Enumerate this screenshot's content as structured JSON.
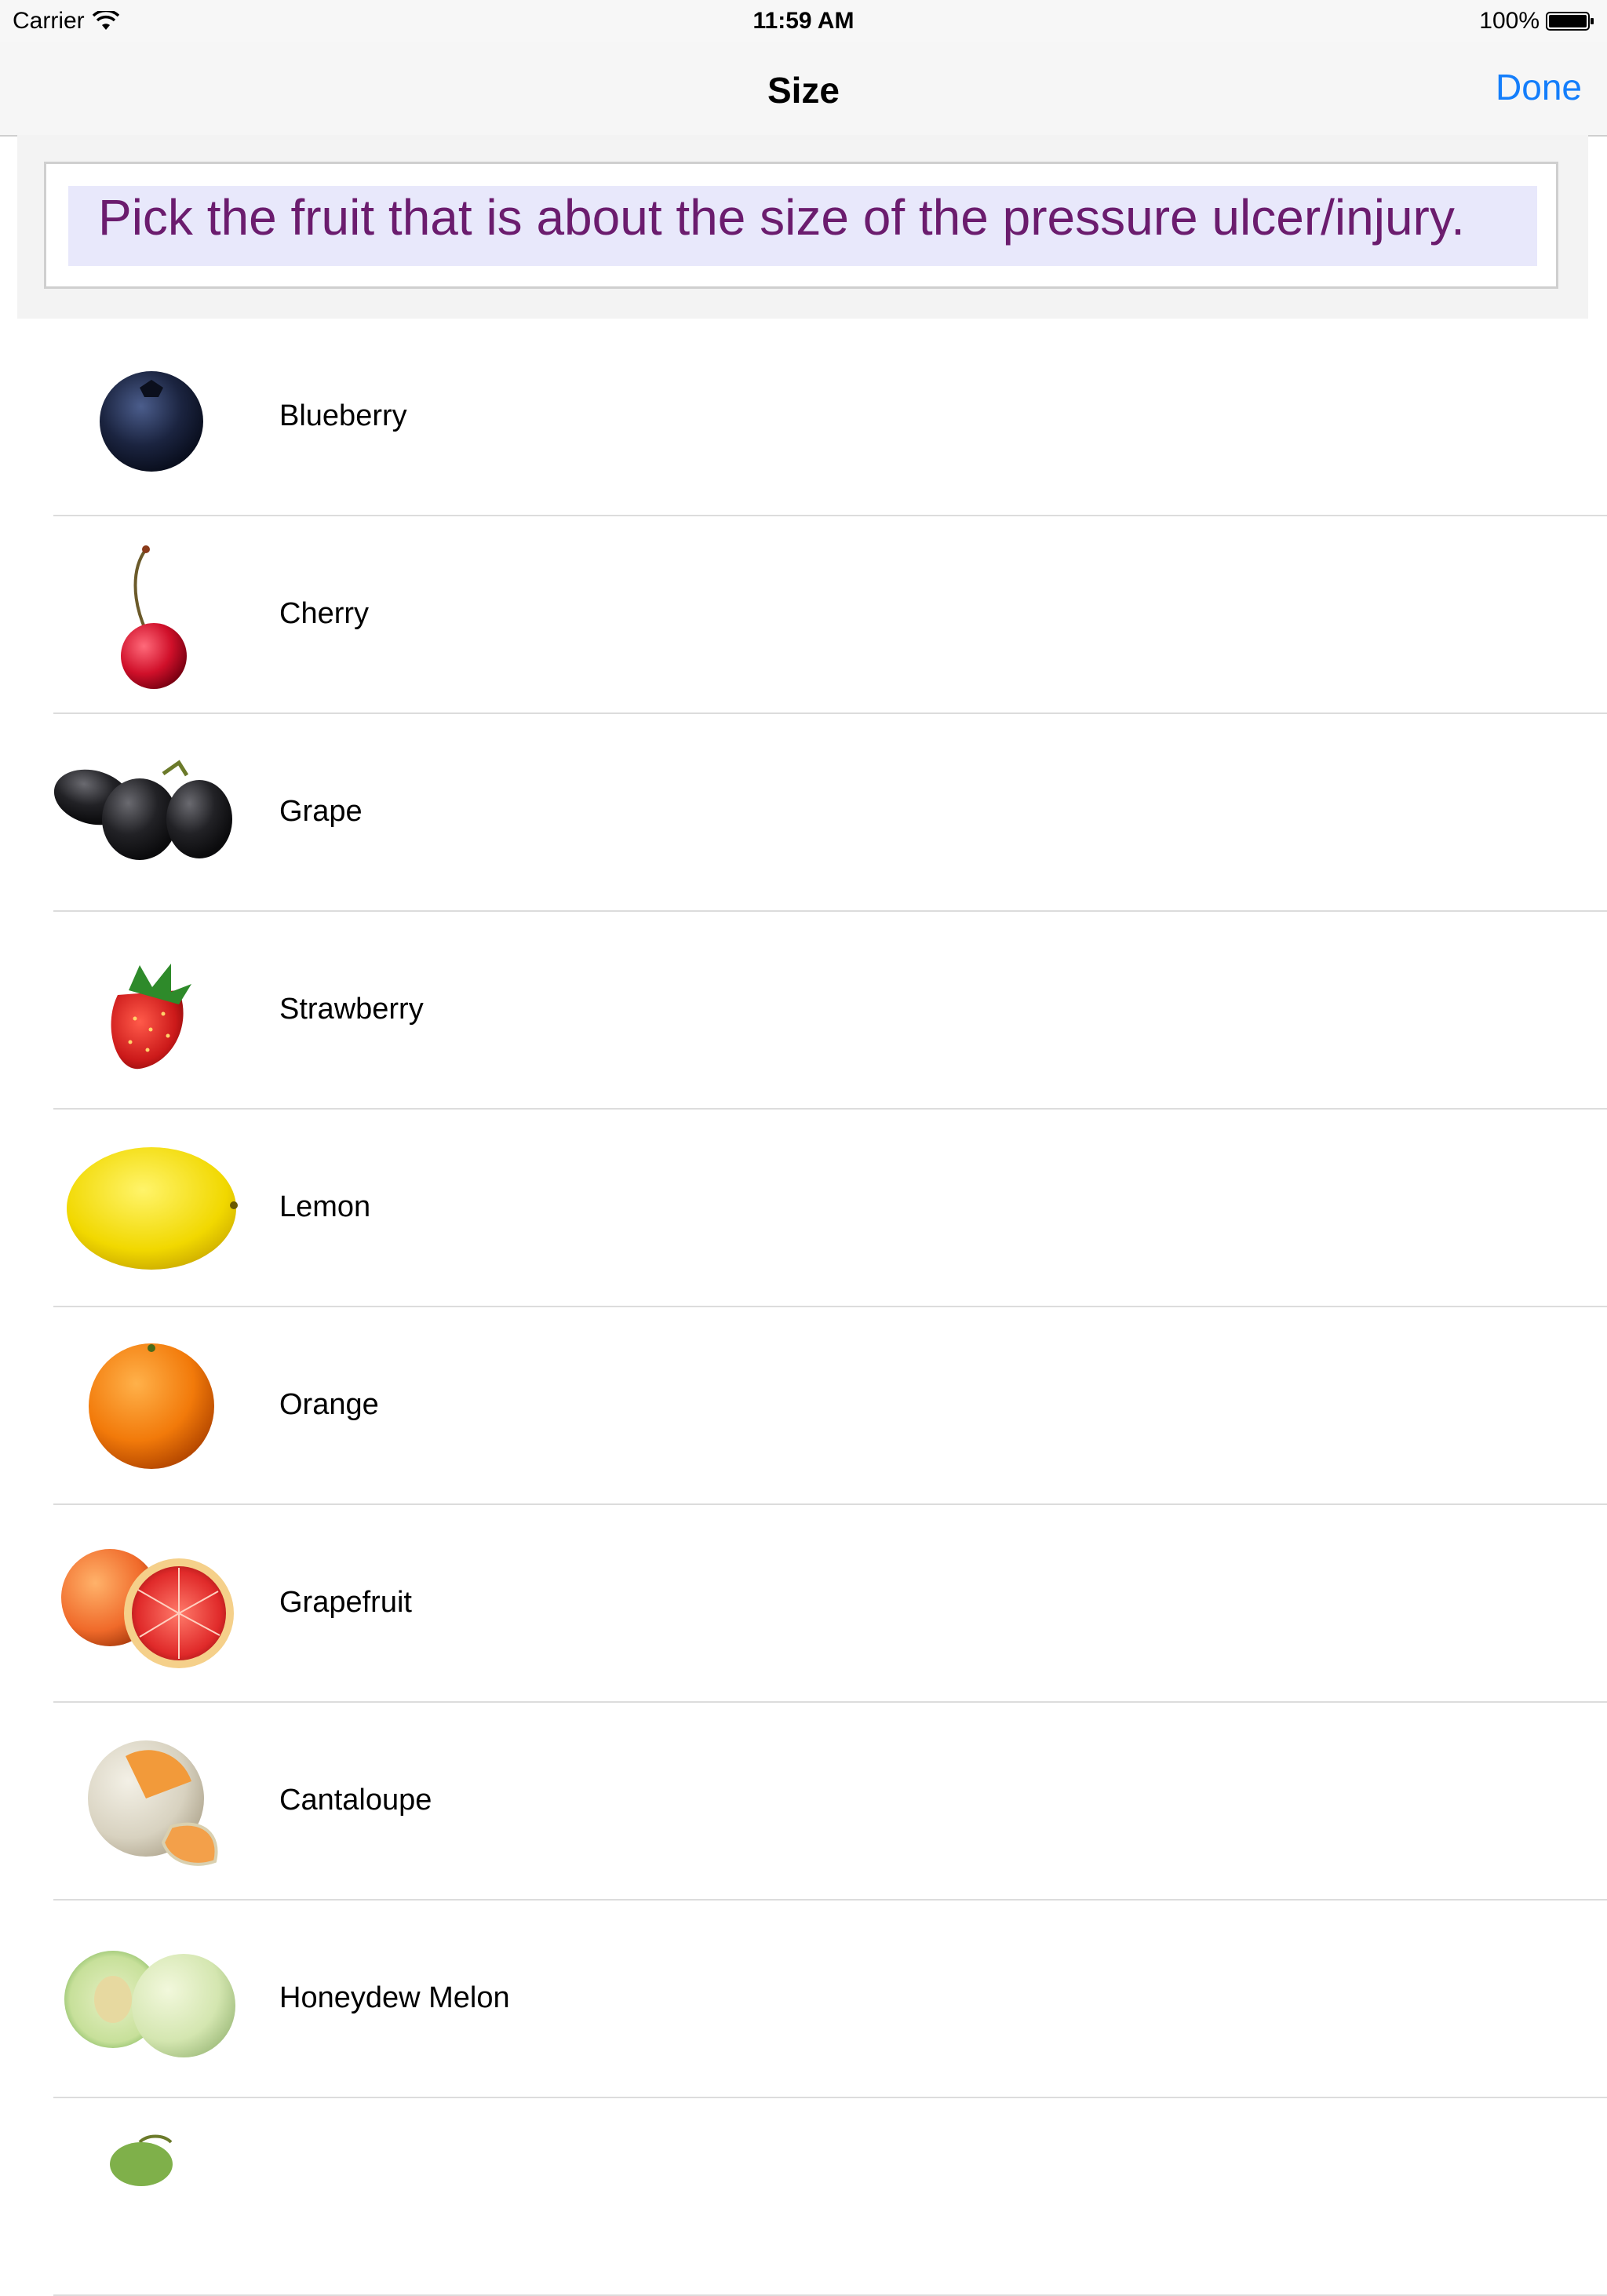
{
  "status_bar": {
    "carrier": "Carrier",
    "time": "11:59 AM",
    "battery": "100%"
  },
  "nav": {
    "title": "Size",
    "done_label": "Done"
  },
  "instruction": {
    "text": "Pick the fruit that is about the size of the pressure ulcer/injury."
  },
  "fruits": [
    {
      "label": "Blueberry",
      "icon": "blueberry-icon"
    },
    {
      "label": "Cherry",
      "icon": "cherry-icon"
    },
    {
      "label": "Grape",
      "icon": "grape-icon"
    },
    {
      "label": "Strawberry",
      "icon": "strawberry-icon"
    },
    {
      "label": "Lemon",
      "icon": "lemon-icon"
    },
    {
      "label": "Orange",
      "icon": "orange-icon"
    },
    {
      "label": "Grapefruit",
      "icon": "grapefruit-icon"
    },
    {
      "label": "Cantaloupe",
      "icon": "cantaloupe-icon"
    },
    {
      "label": "Honeydew Melon",
      "icon": "honeydew-icon"
    }
  ],
  "colors": {
    "accent": "#147efb",
    "instruction_text": "#6b1c6e",
    "instruction_bg": "#e8e8fb"
  }
}
